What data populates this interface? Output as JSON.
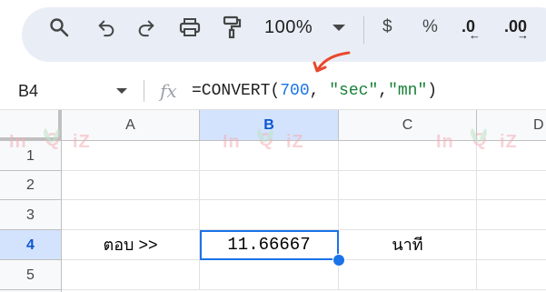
{
  "toolbar": {
    "zoom_value": "100%",
    "currency_label": "$",
    "percent_label": "%",
    "decrease_decimal_label": ".0",
    "increase_decimal_label": ".00",
    "icons": [
      "search-icon",
      "undo-icon",
      "redo-icon",
      "print-icon",
      "paint-format-icon",
      "zoom-dropdown",
      "currency-format",
      "percent-format",
      "decrease-decimal-icon",
      "increase-decimal-icon"
    ]
  },
  "formula_bar": {
    "cell_ref": "B4",
    "fx_label": "fx",
    "formula_parts": {
      "prefix": "=CONVERT(",
      "number": "700",
      "sep1": ", ",
      "unit_from": "\"sec\"",
      "sep2": ",",
      "unit_to": "\"mn\"",
      "suffix": ")"
    }
  },
  "grid": {
    "columns": [
      "A",
      "B",
      "C",
      "D"
    ],
    "rows": [
      "1",
      "2",
      "3",
      "4",
      "5"
    ],
    "selected_column": "B",
    "selected_row": "4",
    "cells": {
      "A4": "ตอบ >>",
      "B4": "11.66667",
      "C4": "นาที"
    }
  },
  "watermark": {
    "text_left": "In",
    "text_right": "iZ"
  },
  "colors": {
    "toolbar_bg": "#e9eef6",
    "selection_blue": "#1a73e8",
    "header_selected_bg": "#d3e3fd",
    "annotation_arrow": "#e8492f",
    "formula_number": "#1a73e8",
    "formula_string": "#188038"
  }
}
